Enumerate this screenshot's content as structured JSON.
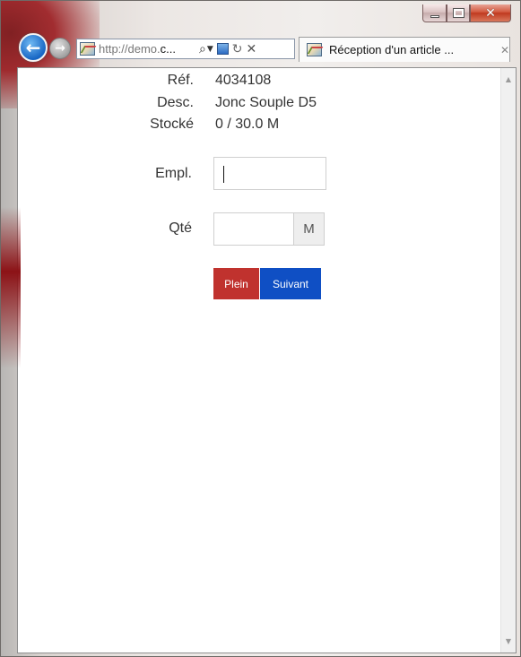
{
  "browser": {
    "url_prefix": "http://demo.",
    "url_highlight": "c...",
    "tab_title": "Réception d'un article ...",
    "icons": [
      "back-arrow-icon",
      "forward-arrow-icon",
      "favicon",
      "search-icon",
      "dropdown-icon",
      "compatibility-icon",
      "refresh-icon",
      "stop-icon",
      "tab-close-icon",
      "minimize-icon",
      "maximize-icon",
      "close-icon"
    ]
  },
  "item": {
    "ref_label": "Réf.",
    "ref_value": "4034108",
    "desc_label": "Desc.",
    "desc_value": "Jonc Souple D5",
    "stock_label": "Stocké",
    "stock_value": "0 / 30.0 M"
  },
  "form": {
    "location_label": "Empl.",
    "location_value": "",
    "quantity_label": "Qté",
    "quantity_value": "",
    "unit": "M",
    "full_button": "Plein",
    "next_button": "Suivant"
  },
  "colors": {
    "full_button": "#c0322e",
    "next_button": "#0f4fc4"
  }
}
